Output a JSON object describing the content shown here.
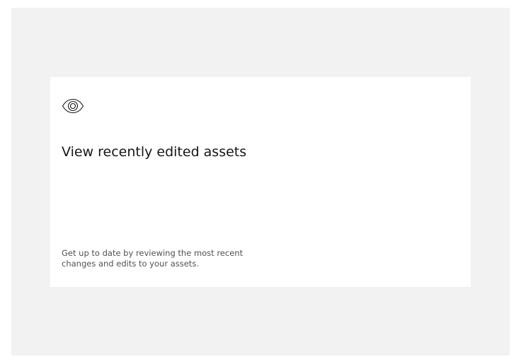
{
  "tile": {
    "icon": "eye-icon",
    "title": "View recently edited assets",
    "description": "Get up to date by reviewing the most recent changes and edits to your assets."
  },
  "colors": {
    "background": "#f2f2f2",
    "tile": "#ffffff",
    "text_primary": "#161616",
    "text_secondary": "#525252"
  }
}
